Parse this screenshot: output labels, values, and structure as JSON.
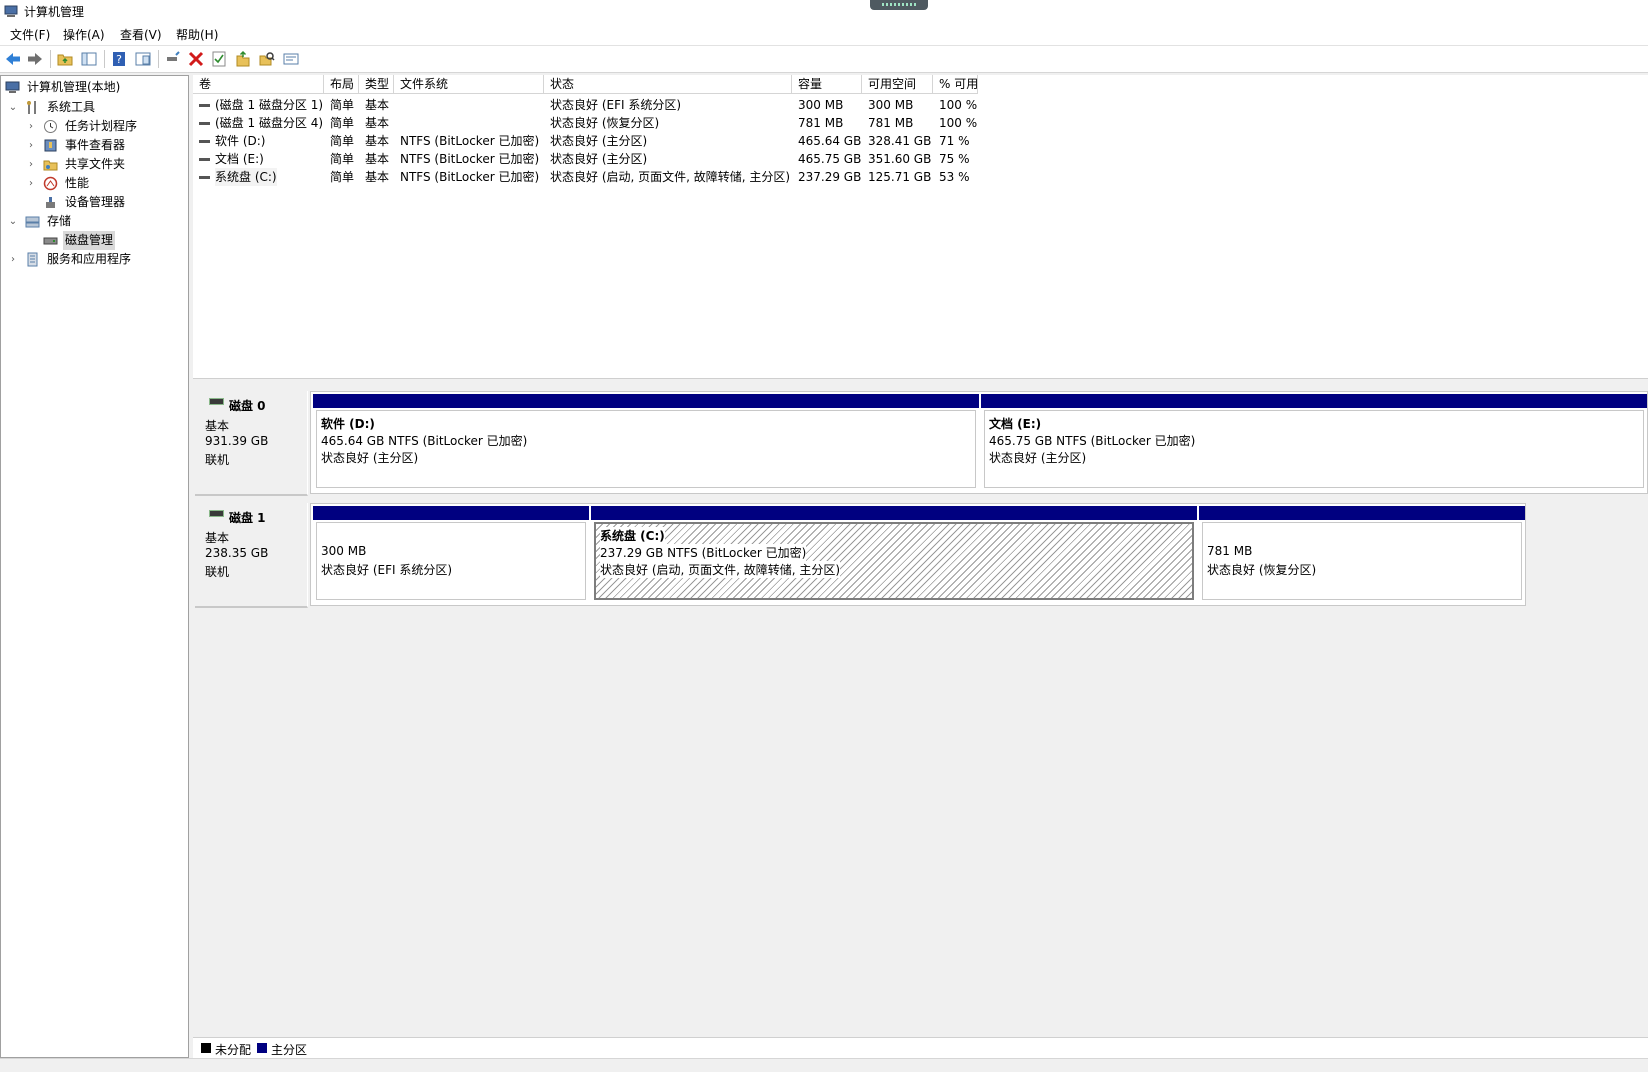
{
  "window": {
    "title": "计算机管理"
  },
  "menu": [
    "文件(F)",
    "操作(A)",
    "查看(V)",
    "帮助(H)"
  ],
  "toolbar_icons": [
    "back-icon",
    "forward-icon",
    "up-folder-icon",
    "show-tree-icon",
    "help-icon",
    "console-icon",
    "connect-icon",
    "delete-icon",
    "check-icon",
    "open-folder-icon",
    "search-icon",
    "properties-icon"
  ],
  "tree": {
    "root": "计算机管理(本地)",
    "system_tools": "系统工具",
    "task_scheduler": "任务计划程序",
    "event_viewer": "事件查看器",
    "shared_folders": "共享文件夹",
    "performance": "性能",
    "device_manager": "设备管理器",
    "storage": "存储",
    "disk_management": "磁盘管理",
    "services_apps": "服务和应用程序"
  },
  "volumes": {
    "columns": [
      "卷",
      "布局",
      "类型",
      "文件系统",
      "状态",
      "容量",
      "可用空间",
      "% 可用"
    ],
    "rows": [
      [
        "(磁盘 1 磁盘分区 1)",
        "简单",
        "基本",
        "",
        "状态良好 (EFI 系统分区)",
        "300 MB",
        "300 MB",
        "100 %"
      ],
      [
        "(磁盘 1 磁盘分区 4)",
        "简单",
        "基本",
        "",
        "状态良好 (恢复分区)",
        "781 MB",
        "781 MB",
        "100 %"
      ],
      [
        "软件 (D:)",
        "简单",
        "基本",
        "NTFS (BitLocker 已加密)",
        "状态良好 (主分区)",
        "465.64 GB",
        "328.41 GB",
        "71 %"
      ],
      [
        "文档 (E:)",
        "简单",
        "基本",
        "NTFS (BitLocker 已加密)",
        "状态良好 (主分区)",
        "465.75 GB",
        "351.60 GB",
        "75 %"
      ],
      [
        "系统盘 (C:)",
        "简单",
        "基本",
        "NTFS (BitLocker 已加密)",
        "状态良好 (启动, 页面文件, 故障转储, 主分区)",
        "237.29 GB",
        "125.71 GB",
        "53 %"
      ]
    ]
  },
  "disks": [
    {
      "name": "磁盘 0",
      "type": "基本",
      "size": "931.39 GB",
      "state": "联机",
      "partitions": [
        {
          "title": "软件  (D:)",
          "line1": "465.64 GB NTFS (BitLocker 已加密)",
          "line2": "状态良好 (主分区)"
        },
        {
          "title": "文档  (E:)",
          "line1": "465.75 GB NTFS (BitLocker 已加密)",
          "line2": "状态良好 (主分区)"
        }
      ]
    },
    {
      "name": "磁盘 1",
      "type": "基本",
      "size": "238.35 GB",
      "state": "联机",
      "partitions": [
        {
          "title": "",
          "line1": "300 MB",
          "line2": "状态良好 (EFI 系统分区)"
        },
        {
          "title": "系统盘  (C:)",
          "line1": "237.29 GB NTFS (BitLocker 已加密)",
          "line2": "状态良好 (启动, 页面文件, 故障转储, 主分区)"
        },
        {
          "title": "",
          "line1": "781 MB",
          "line2": "状态良好 (恢复分区)"
        }
      ]
    }
  ],
  "legend": [
    {
      "label": "未分配",
      "color": "#000000"
    },
    {
      "label": "主分区",
      "color": "#000080"
    }
  ]
}
